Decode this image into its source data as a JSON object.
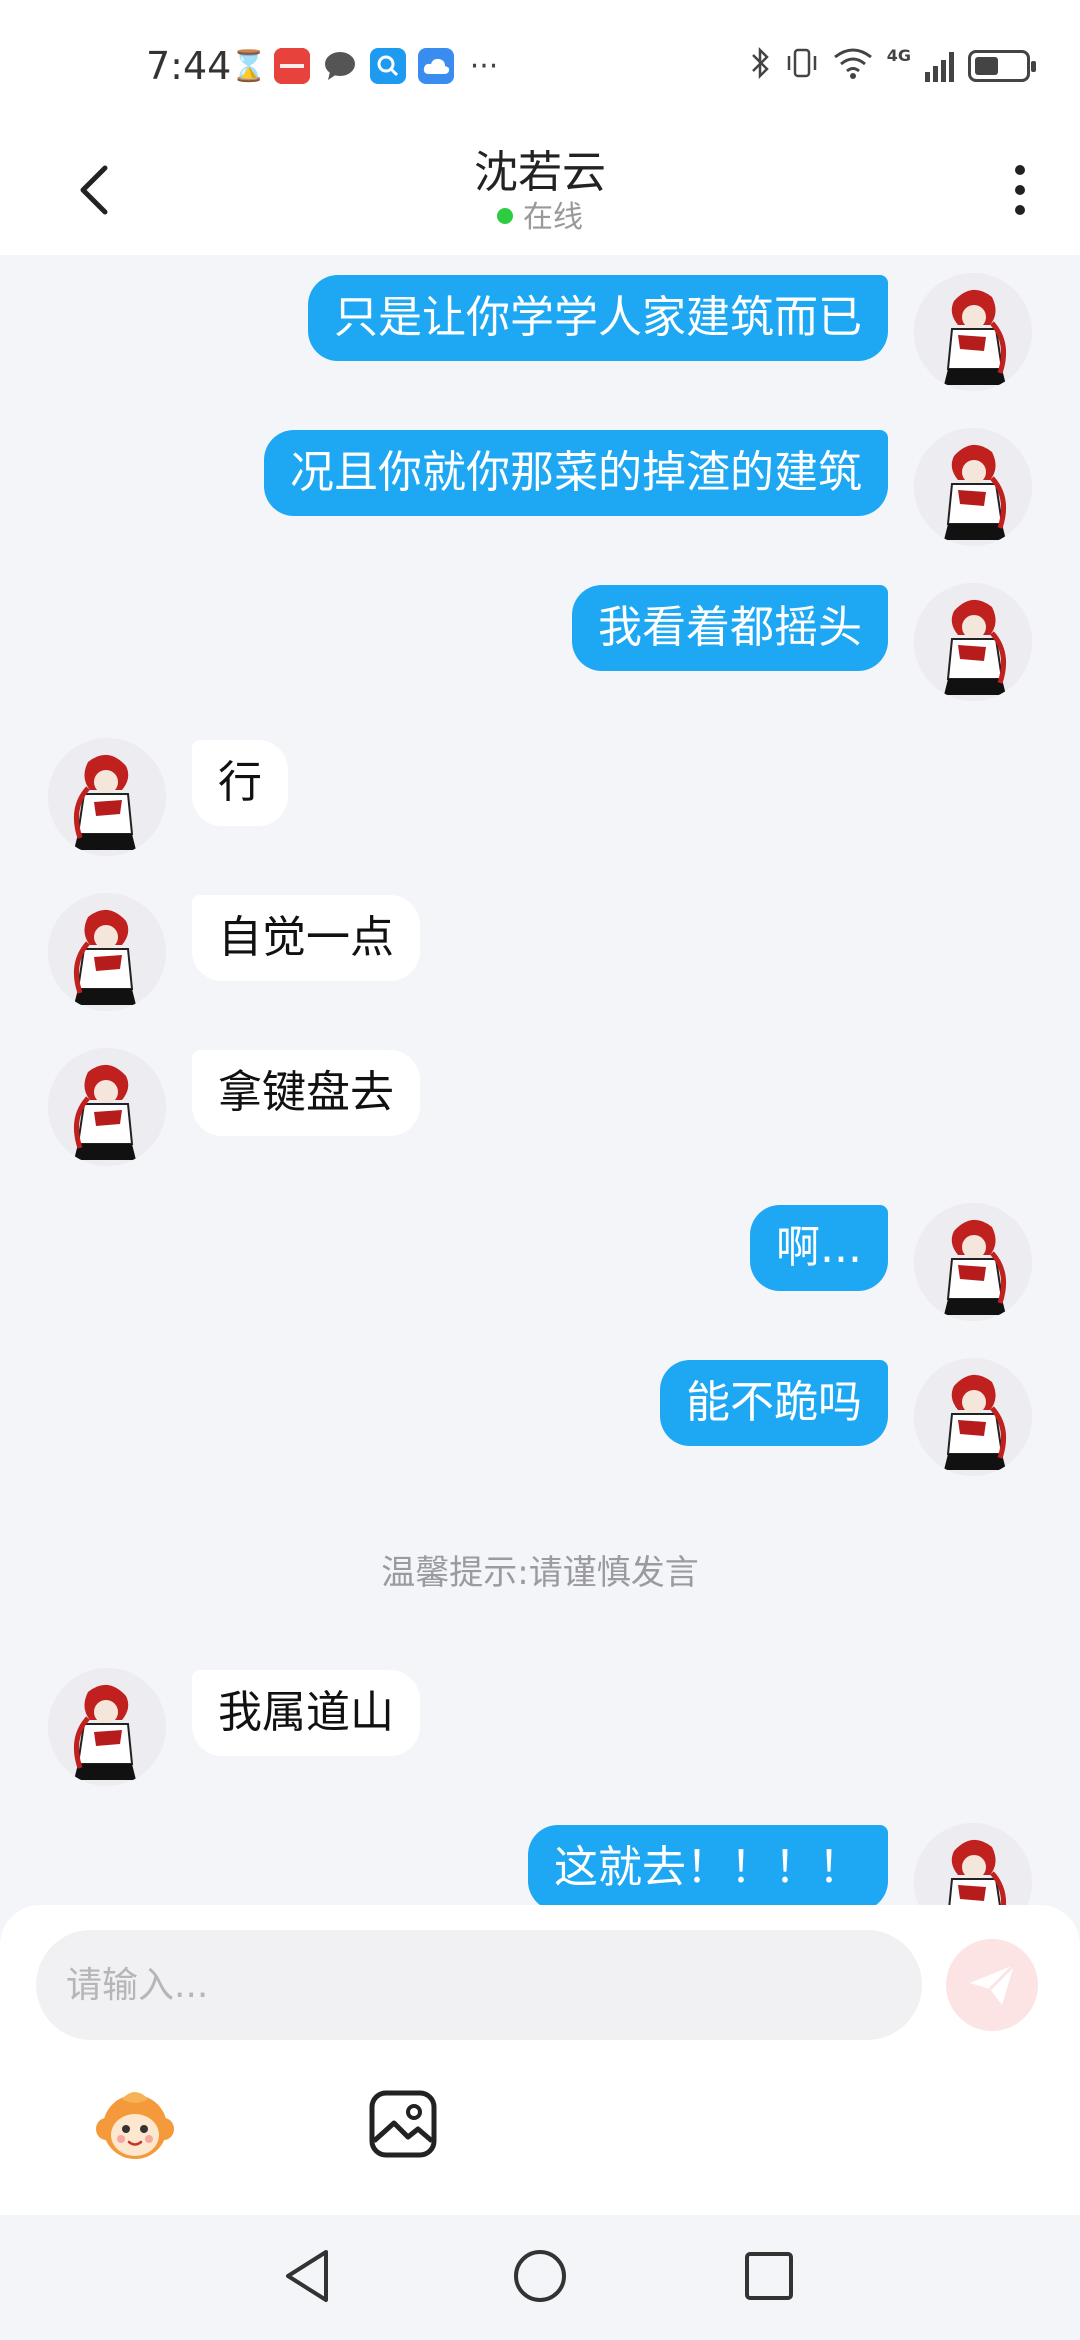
{
  "status_bar": {
    "time": "7:44",
    "left_icons": [
      "hourglass-icon",
      "huawei-app-icon",
      "message-icon",
      "search-app-icon",
      "cloud-app-icon",
      "more-notifications-icon"
    ],
    "more_glyph": "···",
    "right_icons": [
      "bluetooth-icon",
      "vibrate-icon",
      "wifi-icon",
      "4g-icon",
      "signal-icon",
      "battery-icon"
    ],
    "network_label": "4G",
    "battery_level": 0.45
  },
  "header": {
    "title": "沈若云",
    "status": "在线",
    "status_color": "#2ecc40"
  },
  "messages": [
    {
      "side": "out",
      "text": "只是让你学学人家建筑而已"
    },
    {
      "side": "out",
      "text": "况且你就你那菜的掉渣的建筑"
    },
    {
      "side": "out",
      "text": "我看着都摇头"
    },
    {
      "side": "in",
      "text": "行"
    },
    {
      "side": "in",
      "text": "自觉一点"
    },
    {
      "side": "in",
      "text": "拿键盘去"
    },
    {
      "side": "out",
      "text": "啊..."
    },
    {
      "side": "out",
      "text": "能不跪吗"
    },
    {
      "side": "notice",
      "text": "温馨提示:请谨慎发言"
    },
    {
      "side": "in",
      "text": "我属道山"
    },
    {
      "side": "out",
      "text": "这就去！！！！"
    }
  ],
  "input": {
    "placeholder": "请输入..."
  },
  "toolbar": {
    "icons": [
      "emoji-monkey-icon",
      "image-icon"
    ]
  },
  "colors": {
    "outgoing_bubble": "#1ea8f3",
    "incoming_bubble": "#ffffff",
    "chat_background": "#f3f5f8",
    "send_button": "#fde4e4"
  }
}
